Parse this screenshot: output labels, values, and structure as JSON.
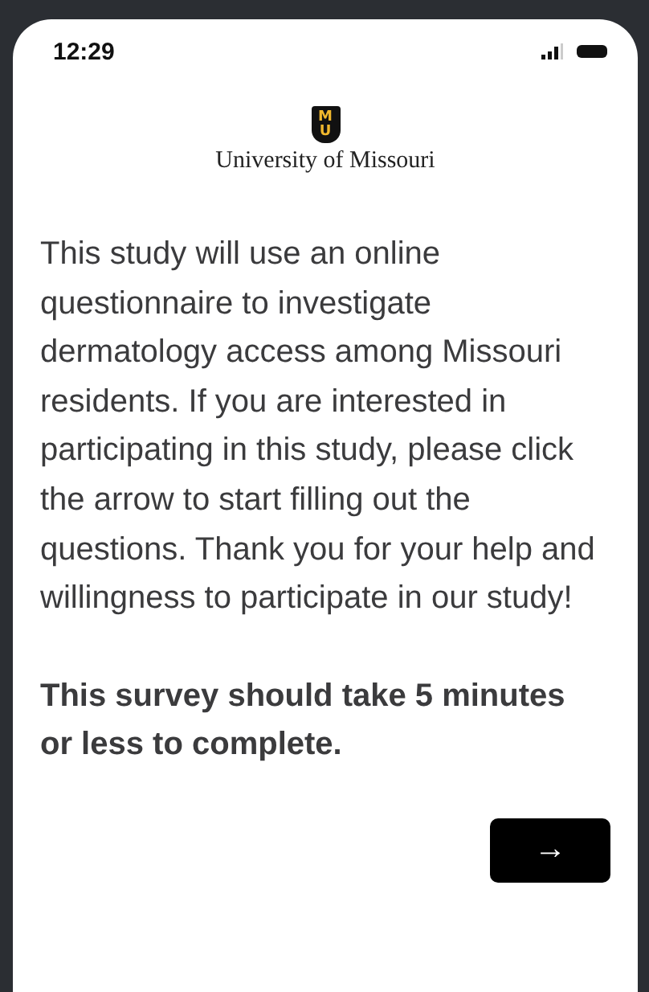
{
  "status_bar": {
    "time": "12:29"
  },
  "logo": {
    "mark_top": "M",
    "mark_bottom": "U",
    "name": "University of Missouri"
  },
  "intro": "This study will use an online questionnaire to investigate dermatology access among Missouri residents. If you are interested in participating in this study, please click the arrow to start filling out the questions. Thank you for your help and willingness to participate in our study!",
  "note": "This survey should take 5 minutes or less to complete.",
  "next_button": {
    "label": "→"
  }
}
